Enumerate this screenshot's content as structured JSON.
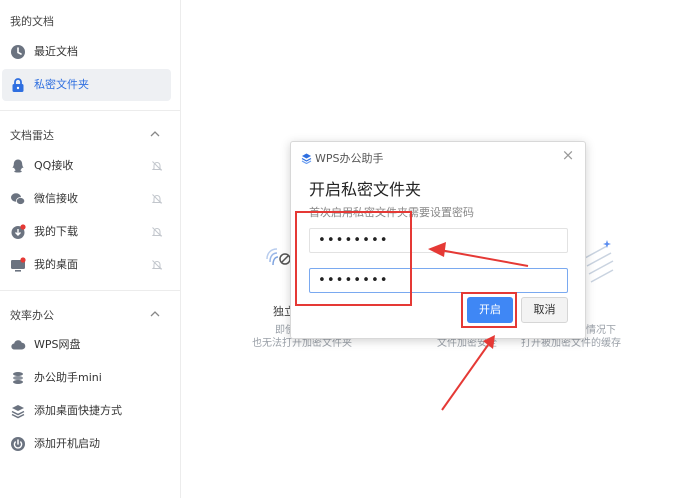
{
  "sidebar": {
    "my_docs_title": "我的文档",
    "recent": "最近文档",
    "private_folder": "私密文件夹",
    "radar_title": "文档雷达",
    "qq": "QQ接收",
    "wechat": "微信接收",
    "downloads": "我的下载",
    "desktop": "我的桌面",
    "efficiency_title": "效率办公",
    "wps_disk": "WPS网盘",
    "assistant_mini": "办公助手mini",
    "add_shortcut": "添加桌面快捷方式",
    "add_startup": "添加开机启动"
  },
  "background": {
    "feature1_title_partial": "独立",
    "feature1_line1_partial": "即使",
    "feature1_line2": "也无法打开加密文件夹",
    "feature2_line2": "文件加密安全",
    "feature3_line1_partial": "情况下",
    "feature3_line2": "打开被加密文件的缓存"
  },
  "dialog": {
    "app_name": "WPS办公助手",
    "close": "×",
    "title": "开启私密文件夹",
    "subtitle": "首次启用私密文件夹需要设置密码",
    "password1": "••••••••",
    "password2": "••••••••",
    "ok": "开启",
    "cancel": "取消"
  },
  "colors": {
    "accent": "#3f87f5",
    "annotation": "#e53935",
    "active_bg": "#eef0f3"
  }
}
